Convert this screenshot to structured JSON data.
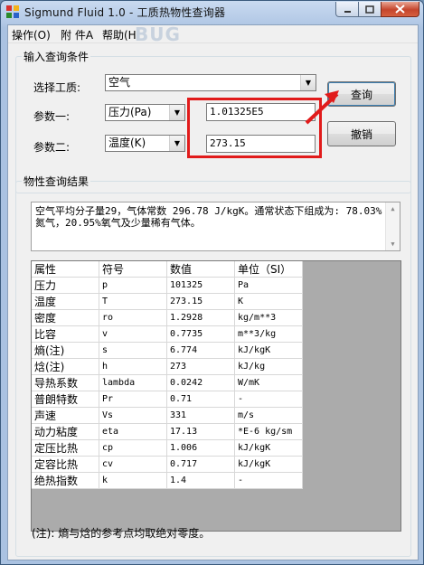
{
  "window": {
    "title": "Sigmund Fluid 1.0 - 工质热物性查询器",
    "watermark": "BUG"
  },
  "menu": [
    {
      "label": "操作(O)"
    },
    {
      "label": "附 件A"
    },
    {
      "label": "帮助(H)"
    }
  ],
  "query": {
    "legend": "输入查询条件",
    "fluid_label": "选择工质:",
    "fluid_value": "空气",
    "param1_label": "参数一:",
    "param1_type": "压力(Pa)",
    "param1_value": "1.01325E5",
    "param2_label": "参数二:",
    "param2_type": "温度(K)",
    "param2_value": "273.15",
    "query_button": "查询",
    "cancel_button": "撤销"
  },
  "results": {
    "legend": "物性查询结果",
    "description": "空气平均分子量29，气体常数 296.78 J/kgK。通常状态下组成为: 78.03%氮气，20.95%氧气及少量稀有气体。",
    "columns": [
      "属性",
      "符号",
      "数值",
      "单位（SI）"
    ],
    "rows": [
      [
        "压力",
        "p",
        "101325",
        "Pa"
      ],
      [
        "温度",
        "T",
        "273.15",
        "K"
      ],
      [
        "密度",
        "ro",
        "1.2928",
        "kg/m**3"
      ],
      [
        "比容",
        "v",
        "0.7735",
        "m**3/kg"
      ],
      [
        "熵(注)",
        "s",
        "6.774",
        "kJ/kgK"
      ],
      [
        "焓(注)",
        "h",
        "273",
        "kJ/kg"
      ],
      [
        "导热系数",
        "lambda",
        "0.0242",
        "W/mK"
      ],
      [
        "普朗特数",
        "Pr",
        "0.71",
        "-"
      ],
      [
        "声速",
        "Vs",
        "331",
        "m/s"
      ],
      [
        "动力粘度",
        "eta",
        "17.13",
        "*E-6 kg/sm"
      ],
      [
        "定压比热",
        "cp",
        "1.006",
        "kJ/kgK"
      ],
      [
        "定容比热",
        "cv",
        "0.717",
        "kJ/kgK"
      ],
      [
        "绝热指数",
        "k",
        "1.4",
        "-"
      ]
    ],
    "note": "(注): 熵与焓的参考点均取绝对零度。"
  },
  "colors": {
    "highlight": "#e11b1b",
    "close_button": "#c5452c"
  }
}
